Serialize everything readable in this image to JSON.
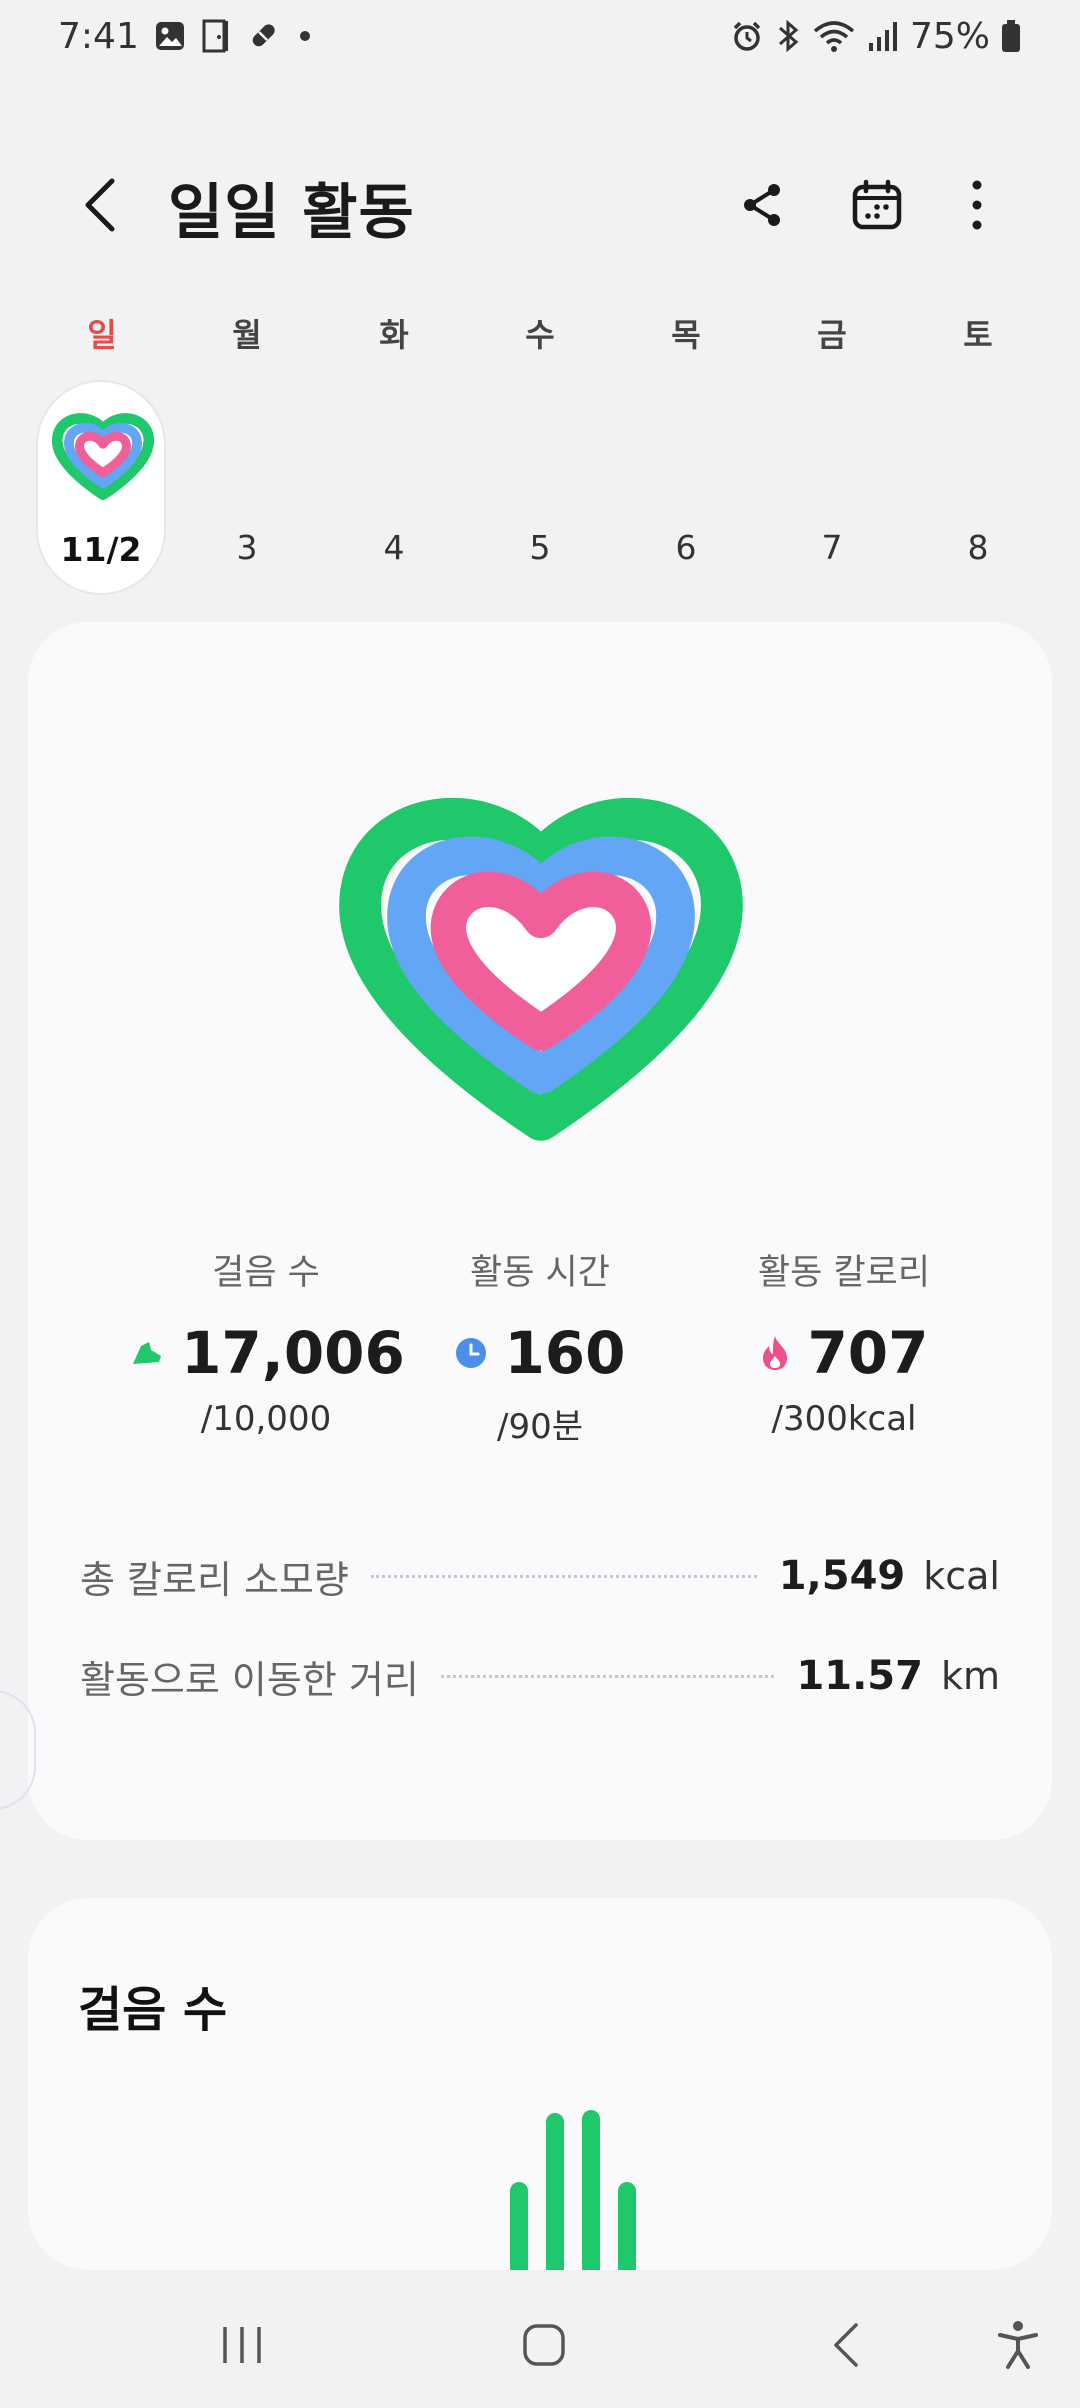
{
  "status_bar": {
    "time": "7:41",
    "battery": "75%",
    "left_icons": [
      "gallery-icon",
      "door-icon",
      "pill-icon",
      "dot-icon"
    ],
    "right_icons": [
      "alarm-icon",
      "bluetooth-icon",
      "wifi-icon",
      "signal-icon",
      "battery-icon"
    ]
  },
  "header": {
    "title": "일일 활동",
    "icons": [
      "back-icon",
      "share-icon",
      "calendar-icon",
      "more-icon"
    ]
  },
  "week": {
    "day_names": [
      "일",
      "월",
      "화",
      "수",
      "목",
      "금",
      "토"
    ],
    "dates": [
      "11/2",
      "3",
      "4",
      "5",
      "6",
      "7",
      "8"
    ],
    "selected_index": 0
  },
  "activity": {
    "stats": [
      {
        "label": "걸음 수",
        "value": "17,006",
        "goal": "/10,000",
        "icon": "shoe-icon",
        "color": "#1ec86b"
      },
      {
        "label": "활동 시간",
        "value": "160",
        "goal": "/90분",
        "icon": "clock-icon",
        "color": "#4a90e8"
      },
      {
        "label": "활동 칼로리",
        "value": "707",
        "goal": "/300kcal",
        "icon": "flame-icon",
        "color": "#f0508a"
      }
    ],
    "summary": [
      {
        "label": "총 칼로리 소모량",
        "value": "1,549",
        "unit": "kcal"
      },
      {
        "label": "활동으로 이동한 거리",
        "value": "11.57",
        "unit": "km"
      }
    ],
    "ring_colors": {
      "steps": "#1ec86b",
      "active_time": "#63a6f6",
      "calories": "#f05f9a"
    }
  },
  "steps_card": {
    "title": "걸음 수",
    "bar_levels": [
      0.55,
      0.98,
      1.0,
      0.55
    ]
  },
  "nav": {
    "icons": [
      "recent-apps-icon",
      "home-icon",
      "back-nav-icon",
      "accessibility-icon"
    ]
  }
}
